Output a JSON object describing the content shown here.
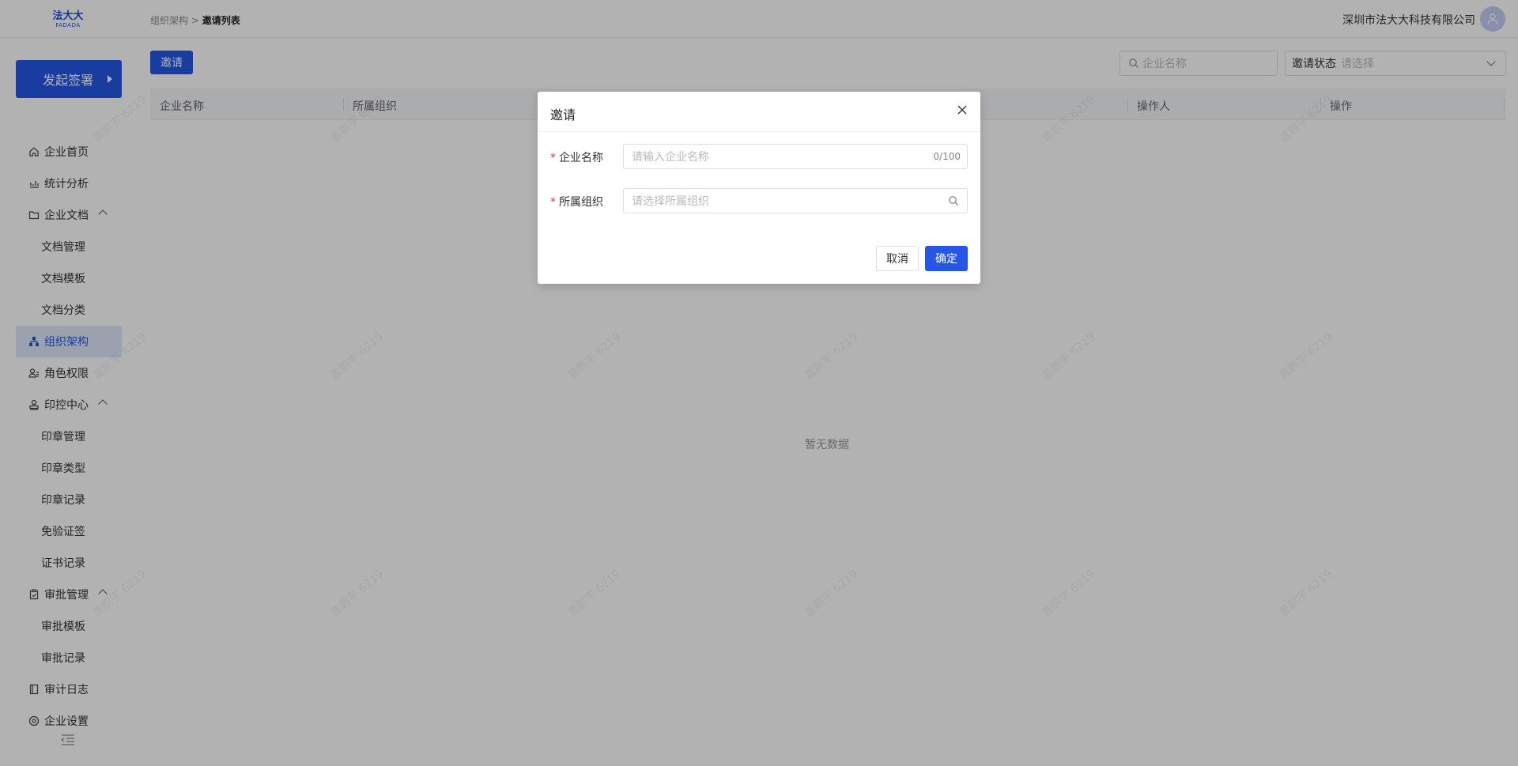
{
  "header": {
    "logo_cn": "法大大",
    "logo_en": "FADADA",
    "breadcrumb_parent": "组织架构",
    "breadcrumb_sep": ">",
    "breadcrumb_current": "邀请列表",
    "company_name": "深圳市法大大科技有限公司",
    "avatar_icon": "user-icon"
  },
  "sidebar": {
    "start_button": "发起签署",
    "items": [
      {
        "label": "企业首页",
        "icon": "home-icon",
        "level": "top"
      },
      {
        "label": "统计分析",
        "icon": "chart-icon",
        "level": "top"
      },
      {
        "label": "企业文档",
        "icon": "folder-icon",
        "level": "top",
        "expanded": true
      },
      {
        "label": "文档管理",
        "level": "sub"
      },
      {
        "label": "文档模板",
        "level": "sub"
      },
      {
        "label": "文档分类",
        "level": "sub"
      },
      {
        "label": "组织架构",
        "icon": "org-icon",
        "level": "top",
        "active": true
      },
      {
        "label": "角色权限",
        "icon": "role-icon",
        "level": "top"
      },
      {
        "label": "印控中心",
        "icon": "stamp-icon",
        "level": "top",
        "expanded": true
      },
      {
        "label": "印章管理",
        "level": "sub"
      },
      {
        "label": "印章类型",
        "level": "sub"
      },
      {
        "label": "印章记录",
        "level": "sub"
      },
      {
        "label": "免验证签",
        "level": "sub"
      },
      {
        "label": "证书记录",
        "level": "sub"
      },
      {
        "label": "审批管理",
        "icon": "clipboard-icon",
        "level": "top",
        "expanded": true
      },
      {
        "label": "审批模板",
        "level": "sub"
      },
      {
        "label": "审批记录",
        "level": "sub"
      },
      {
        "label": "审计日志",
        "icon": "book-icon",
        "level": "top"
      },
      {
        "label": "企业设置",
        "icon": "settings-icon",
        "level": "top"
      }
    ]
  },
  "toolbar": {
    "invite_button": "邀请",
    "search_placeholder": "企业名称",
    "status_label": "邀请状态",
    "status_placeholder": "请选择"
  },
  "table": {
    "columns": [
      "企业名称",
      "所属组织",
      "操作人",
      "操作"
    ],
    "empty_text": "暂无数据"
  },
  "watermark": "盖鹏宇 6219",
  "modal": {
    "title": "邀请",
    "fields": [
      {
        "label": "企业名称",
        "placeholder": "请输入企业名称",
        "counter": "0/100",
        "required": true
      },
      {
        "label": "所属组织",
        "placeholder": "请选择所属组织",
        "required": true
      }
    ],
    "cancel": "取消",
    "confirm": "确定"
  }
}
